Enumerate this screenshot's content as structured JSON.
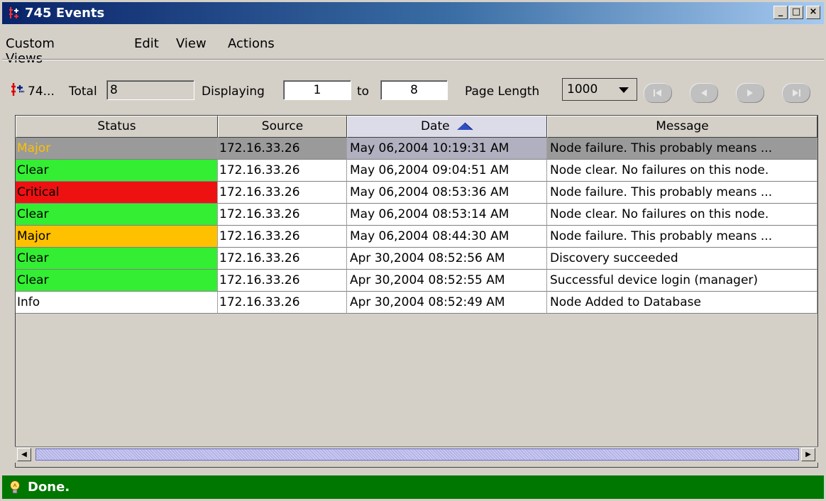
{
  "window": {
    "title": "745 Events",
    "controls": {
      "minimize": "_",
      "maximize": "□",
      "close": "×"
    }
  },
  "menu": [
    "Custom Views",
    "Edit",
    "View",
    "Actions"
  ],
  "toolbar": {
    "view_label": "74...",
    "total_label": "Total",
    "total_value": "8",
    "displaying_label": "Displaying",
    "from_value": "1",
    "to_label": "to",
    "to_value": "8",
    "page_length_label": "Page Length",
    "page_length_value": "1000",
    "nav_icons": [
      "first-page-icon",
      "previous-page-icon",
      "next-page-icon",
      "last-page-icon"
    ]
  },
  "table": {
    "columns": [
      "Status",
      "Source",
      "Date",
      "Message"
    ],
    "sorted_column": "Date",
    "sort_direction": "ascending",
    "rows": [
      {
        "status": "Major",
        "source": "172.16.33.26",
        "date": "May 06,2004 10:19:31 AM",
        "message": "Node failure.  This probably means ...",
        "selected": true
      },
      {
        "status": "Clear",
        "source": "172.16.33.26",
        "date": "May 06,2004 09:04:51 AM",
        "message": "Node clear.  No failures on this node."
      },
      {
        "status": "Critical",
        "source": "172.16.33.26",
        "date": "May 06,2004 08:53:36 AM",
        "message": "Node failure.  This probably means ..."
      },
      {
        "status": "Clear",
        "source": "172.16.33.26",
        "date": "May 06,2004 08:53:14 AM",
        "message": "Node clear.  No failures on this node."
      },
      {
        "status": "Major",
        "source": "172.16.33.26",
        "date": "May 06,2004 08:44:30 AM",
        "message": "Node failure.  This probably means ..."
      },
      {
        "status": "Clear",
        "source": "172.16.33.26",
        "date": "Apr 30,2004 08:52:56 AM",
        "message": "Discovery succeeded"
      },
      {
        "status": "Clear",
        "source": "172.16.33.26",
        "date": "Apr 30,2004 08:52:55 AM",
        "message": "Successful device login (manager)"
      },
      {
        "status": "Info",
        "source": "172.16.33.26",
        "date": "Apr 30,2004 08:52:49 AM",
        "message": "Node Added to Database"
      }
    ]
  },
  "status_colors": {
    "Major": "#ffc000",
    "Clear": "#33ee33",
    "Critical": "#ee1111",
    "Info": "#ffffff"
  },
  "statusbar": {
    "message": "Done."
  }
}
